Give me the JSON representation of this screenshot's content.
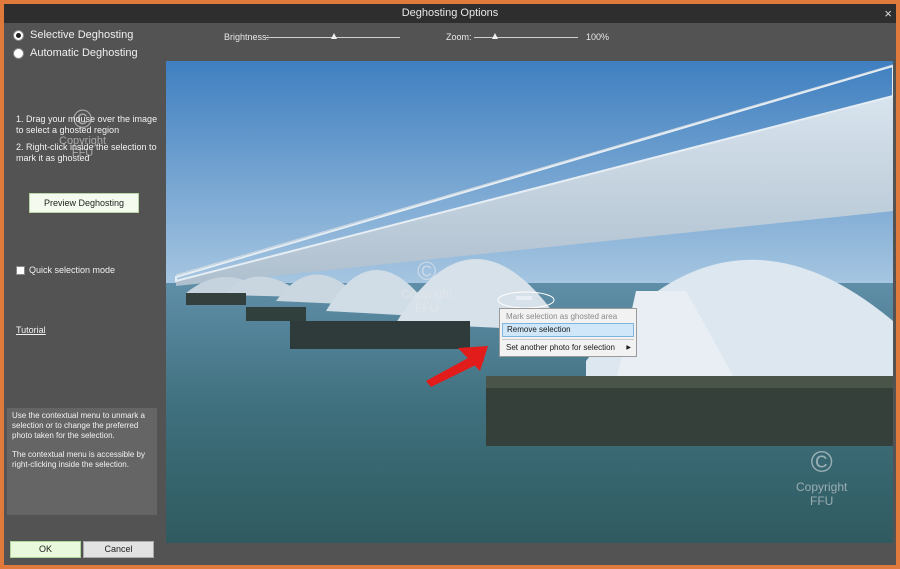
{
  "window": {
    "title": "Deghosting Options",
    "close_glyph": "×"
  },
  "mode": {
    "selective_label": "Selective Deghosting",
    "automatic_label": "Automatic Deghosting",
    "selected": "selective"
  },
  "brightness": {
    "label": "Brightness:",
    "level": 0.6
  },
  "zoom": {
    "label": "Zoom:",
    "level": 0.2,
    "value": "100%"
  },
  "instructions": {
    "step1": "1. Drag your mouse over the image to select a ghosted region",
    "step2": "2. Right-click inside the selection to mark it as ghosted"
  },
  "preview_button": "Preview Deghosting",
  "quick_selection": {
    "label": "Quick selection mode",
    "checked": false
  },
  "tutorial_link": "Tutorial",
  "info": {
    "para1": "Use the contextual menu to unmark a selection or to change the preferred photo taken for the selection.",
    "para2": "The contextual menu is accessible by right-clicking inside the selection."
  },
  "ok_button": "OK",
  "cancel_button": "Cancel",
  "context_menu": {
    "items": [
      {
        "label": "Mark selection as ghosted area",
        "state": "disabled"
      },
      {
        "label": "Remove selection",
        "state": "highlighted"
      },
      {
        "label": "Set another photo for selection",
        "state": "submenu"
      }
    ]
  },
  "watermark": {
    "line1": "Copyright",
    "line2": "FFU",
    "symbol": "©"
  },
  "colors": {
    "window_bg": "#535353",
    "titlebar_bg": "#2e2e2e",
    "frame": "#e07a3c",
    "arrow": "#e21b1b",
    "ok_bg": "#e9f9dc"
  }
}
